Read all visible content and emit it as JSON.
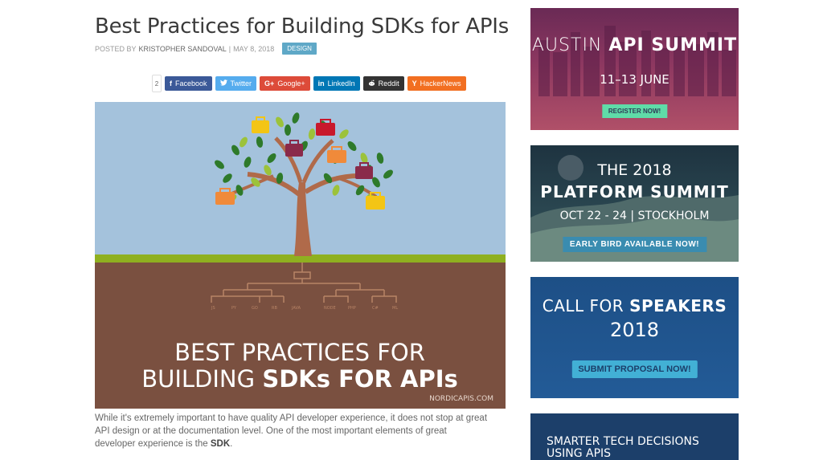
{
  "article": {
    "title": "Best Practices for Building SDKs for APIs",
    "posted_by_label": "POSTED BY",
    "author": "KRISTOPHER SANDOVAL",
    "separator": "|",
    "date": "MAY 8, 2018",
    "tag": "DESIGN",
    "share_count": "2",
    "share_buttons": [
      {
        "label": "Facebook",
        "icon": "facebook-icon",
        "glyph": "f",
        "color": "#3b5998"
      },
      {
        "label": "Twitter",
        "icon": "twitter-icon",
        "glyph": "🐦",
        "color": "#55acee"
      },
      {
        "label": "Google+",
        "icon": "google-plus-icon",
        "glyph": "G+",
        "color": "#dd4b39"
      },
      {
        "label": "LinkedIn",
        "icon": "linkedin-icon",
        "glyph": "in",
        "color": "#0077b5"
      },
      {
        "label": "Reddit",
        "icon": "reddit-icon",
        "glyph": "●",
        "color": "#333333"
      },
      {
        "label": "HackerNews",
        "icon": "hackernews-icon",
        "glyph": "Y",
        "color": "#f26f21"
      }
    ],
    "hero": {
      "line1": "BEST PRACTICES FOR",
      "line2_a": "BUILDING ",
      "line2_b": "SDKs FOR APIs",
      "watermark": "NORDICAPIS.COM"
    },
    "body_line1": "While it's extremely important to have quality API developer experience, it does not stop at great",
    "body_line2": "API design or at the documentation level. One of the most important elements of great",
    "body_line3_a": "developer experience is the ",
    "body_line3_b": "SDK",
    "body_line3_c": "."
  },
  "sidebar": {
    "ad1": {
      "line1_a": "AUSTIN ",
      "line1_b": "API SUMMIT",
      "line2": "11–13 JUNE",
      "button": "REGISTER NOW!"
    },
    "ad2": {
      "line1": "THE 2018",
      "line2": "PLATFORM SUMMIT",
      "line3": "OCT 22 - 24 | STOCKHOLM",
      "button": "EARLY BIRD AVAILABLE NOW!"
    },
    "ad3": {
      "line1_a": "CALL FOR ",
      "line1_b": "SPEAKERS",
      "line2": "2018",
      "button": "SUBMIT PROPOSAL NOW!"
    },
    "ad4": {
      "line1": "SMARTER TECH DECISIONS",
      "line2": "USING APIS"
    }
  },
  "colors": {
    "tag": "#5fa8c7",
    "hero_sky": "#a4c2dc",
    "hero_grass": "#8fb020",
    "hero_soil": "#7a5040",
    "ad3_button": "#42b0d5",
    "ad1_button": "#5fdca8"
  }
}
